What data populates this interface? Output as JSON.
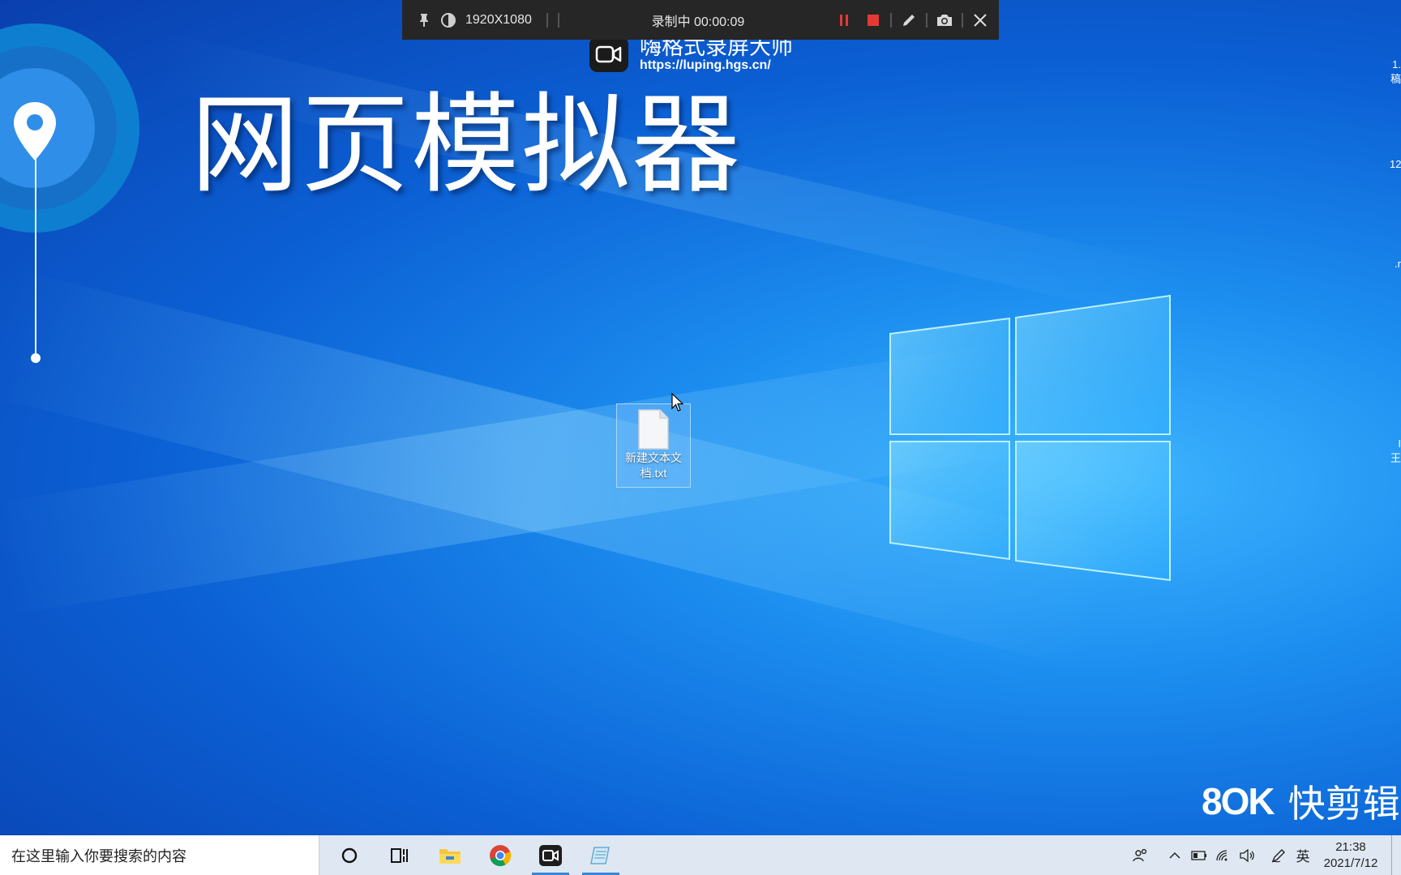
{
  "recorder_bar": {
    "resolution": "1920X1080",
    "status": "录制中 00:00:09",
    "icons": [
      "pin-icon",
      "contrast-icon",
      "pause-icon",
      "stop-icon",
      "pen-icon",
      "camera-icon",
      "close-icon"
    ]
  },
  "watermark": {
    "title": "嗨格式录屏大师",
    "url": "https://luping.hgs.cn/"
  },
  "overlay": {
    "title": "网页模拟器"
  },
  "desktop": {
    "icons": [
      {
        "label": "新建文本文档.txt",
        "icon": "text-file-icon"
      }
    ],
    "edge_texts": [
      "1.",
      "稿",
      "12",
      ".r",
      "I",
      "王"
    ]
  },
  "editor_watermark": {
    "text": "快剪辑"
  },
  "taskbar": {
    "search_placeholder": "在这里输入你要搜索的内容",
    "buttons": [
      "cortana-icon",
      "task-view-icon",
      "file-explorer-icon",
      "chrome-icon",
      "recorder-app-icon",
      "notepad-icon"
    ],
    "tray": {
      "ime": "英",
      "time": "21:38",
      "date": "2021/7/12"
    }
  },
  "colors": {
    "accent": "#3a86d8",
    "record_red": "#e53935",
    "toolbar_bg": "#262626",
    "taskbar_bg": "#dfe8f2"
  }
}
